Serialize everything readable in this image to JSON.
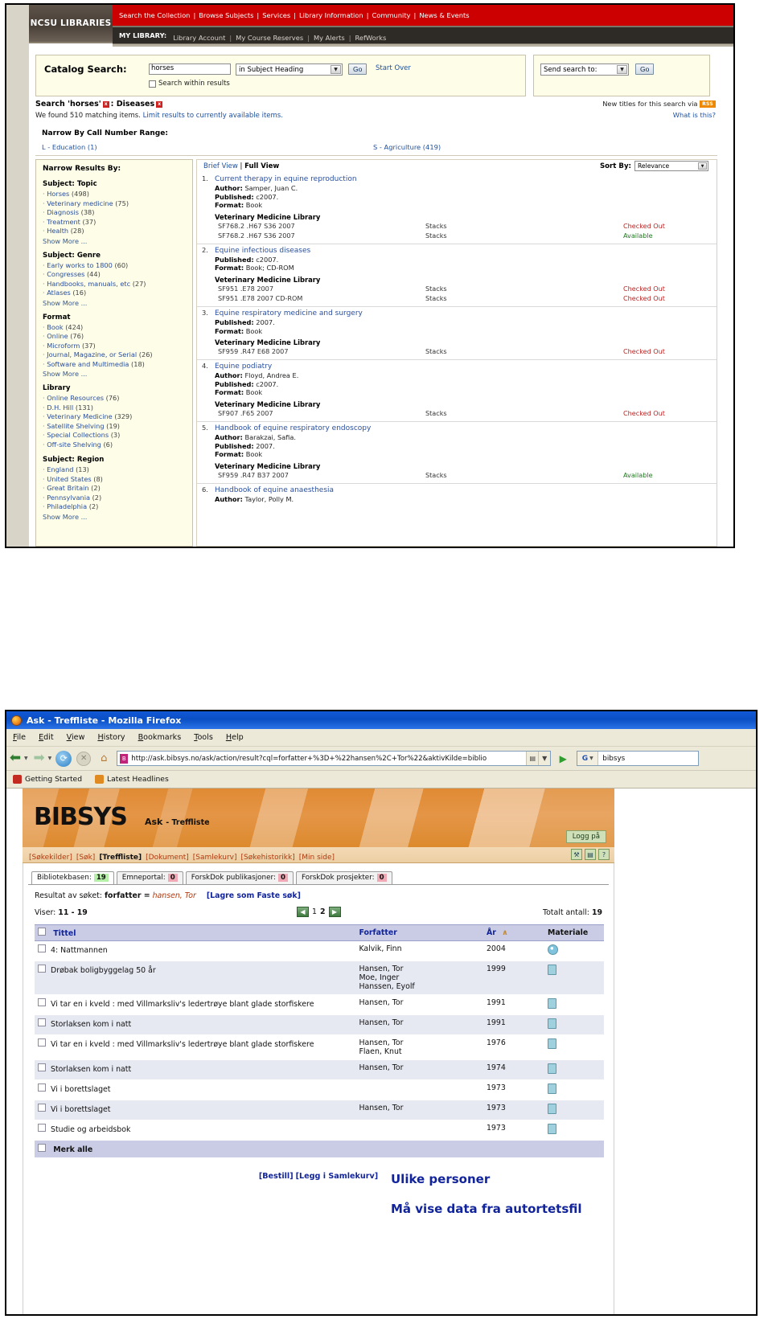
{
  "shot1": {
    "brand": "NCSU LIBRARIES",
    "topnav": [
      "Search the Collection",
      "Browse Subjects",
      "Services",
      "Library Information",
      "Community",
      "News & Events"
    ],
    "mylibrary_label": "MY LIBRARY:",
    "mylibrary_items": [
      "Library Account",
      "My Course Reserves",
      "My Alerts",
      "RefWorks"
    ],
    "search": {
      "label": "Catalog Search:",
      "value": "horses",
      "scope": "in Subject Heading",
      "go": "Go",
      "start_over": "Start Over",
      "within_results": "Search within results"
    },
    "send": {
      "select": "Send search to:",
      "go": "Go"
    },
    "search_line_prefix": "Search 'horses'",
    "search_line_facet": ": Diseases",
    "found_text": "We found 510 matching items. ",
    "found_link": "Limit results to currently available items.",
    "rss_text": "New titles for this search via ",
    "rss_badge": "RSS",
    "what_is_this": "What is this?",
    "callnum": {
      "heading": "Narrow By Call Number Range:",
      "left": "L - Education (1)",
      "right": "S - Agriculture (419)"
    },
    "facets": {
      "title": "Narrow Results By:",
      "show_more": "Show More ...",
      "groups": [
        {
          "head": "Subject: Topic",
          "items": [
            "Horses (498)",
            "Veterinary medicine (75)",
            "Diagnosis (38)",
            "Treatment (37)",
            "Health (28)"
          ],
          "more": true
        },
        {
          "head": "Subject: Genre",
          "items": [
            "Early works to 1800 (60)",
            "Congresses (44)",
            "Handbooks, manuals, etc (27)",
            "Atlases (16)"
          ],
          "more": true
        },
        {
          "head": "Format",
          "items": [
            "Book (424)",
            "Online (76)",
            "Microform (37)",
            "Journal, Magazine, or Serial (26)",
            "Software and Multimedia (18)"
          ],
          "more": true
        },
        {
          "head": "Library",
          "items": [
            "Online Resources (76)",
            "D.H. Hill (131)",
            "Veterinary Medicine (329)",
            "Satellite Shelving (19)",
            "Special Collections (3)",
            "Off-site Shelving (6)"
          ],
          "more": false
        },
        {
          "head": "Subject: Region",
          "items": [
            "England (13)",
            "United States (8)",
            "Great Britain (2)",
            "Pennsylvania (2)",
            "Philadelphia (2)"
          ],
          "more": true
        }
      ]
    },
    "results_header": {
      "brief_view": "Brief View",
      "separator": " | ",
      "full_view": "Full View",
      "sort_label": "Sort By:",
      "sort_value": "Relevance"
    },
    "results": [
      {
        "num": "1.",
        "title": "Current therapy in equine reproduction",
        "author": "Samper, Juan C.",
        "published": "c2007.",
        "format": "Book",
        "library": "Veterinary Medicine Library",
        "holdings": [
          {
            "call": "SF768.2 .H67 S36 2007",
            "loc": "Stacks",
            "status": "Checked Out",
            "ok": false
          },
          {
            "call": "SF768.2 .H67 S36 2007",
            "loc": "Stacks",
            "status": "Available",
            "ok": true
          }
        ]
      },
      {
        "num": "2.",
        "title": "Equine infectious diseases",
        "author": "",
        "published": "c2007.",
        "format": "Book; CD-ROM",
        "library": "Veterinary Medicine Library",
        "holdings": [
          {
            "call": "SF951 .E78 2007",
            "loc": "Stacks",
            "status": "Checked Out",
            "ok": false
          },
          {
            "call": "SF951 .E78 2007 CD-ROM",
            "loc": "Stacks",
            "status": "Checked Out",
            "ok": false
          }
        ]
      },
      {
        "num": "3.",
        "title": "Equine respiratory medicine and surgery",
        "author": "",
        "published": "2007.",
        "format": "Book",
        "library": "Veterinary Medicine Library",
        "holdings": [
          {
            "call": "SF959 .R47 E68 2007",
            "loc": "Stacks",
            "status": "Checked Out",
            "ok": false
          }
        ]
      },
      {
        "num": "4.",
        "title": "Equine podiatry",
        "author": "Floyd, Andrea E.",
        "published": "c2007.",
        "format": "Book",
        "library": "Veterinary Medicine Library",
        "holdings": [
          {
            "call": "SF907 .F65 2007",
            "loc": "Stacks",
            "status": "Checked Out",
            "ok": false
          }
        ]
      },
      {
        "num": "5.",
        "title": "Handbook of equine respiratory endoscopy",
        "author": "Barakzai, Safia.",
        "published": "2007.",
        "format": "Book",
        "library": "Veterinary Medicine Library",
        "holdings": [
          {
            "call": "SF959 .R47 B37 2007",
            "loc": "Stacks",
            "status": "Available",
            "ok": true
          }
        ]
      },
      {
        "num": "6.",
        "title": "Handbook of equine anaesthesia",
        "author": "Taylor, Polly M.",
        "published": "",
        "format": "",
        "library": "",
        "holdings": []
      }
    ],
    "labels": {
      "author": "Author:",
      "published": "Published:",
      "format": "Format:"
    }
  },
  "shot2": {
    "window_title": "Ask - Treffliste - Mozilla Firefox",
    "menu": [
      "File",
      "Edit",
      "View",
      "History",
      "Bookmarks",
      "Tools",
      "Help"
    ],
    "url": "http://ask.bibsys.no/ask/action/result?cql=forfatter+%3D+%22hansen%2C+Tor%22&aktivKilde=biblio",
    "search_engine": "G",
    "search_value": "bibsys",
    "bookmarks": [
      "Getting Started",
      "Latest Headlines"
    ],
    "logo": "BIBSYS",
    "app_title": "Ask",
    "app_subtitle": "- Treffliste",
    "login_button": "Logg på",
    "navstrip": [
      "[Søkekilder]",
      "[Søk]",
      "[Treffliste]",
      "[Dokument]",
      "[Samlekurv]",
      "[Søkehistorikk]",
      "[Min side]"
    ],
    "navstrip_active_index": 2,
    "nav_icons": [
      "tools-icon",
      "print-icon",
      "help-icon"
    ],
    "tabs": [
      {
        "label": "Bibliotekbasen:",
        "count": "19",
        "active": true
      },
      {
        "label": "Emneportal:",
        "count": "0",
        "active": false
      },
      {
        "label": "ForskDok publikasjoner:",
        "count": "0",
        "active": false
      },
      {
        "label": "ForskDok prosjekter:",
        "count": "0",
        "active": false
      }
    ],
    "result_prefix": "Resultat av søket:",
    "result_field": "forfatter =",
    "result_value": "hansen, Tor",
    "save_search_link": "[Lagre som Faste søk]",
    "viser_label": "Viser:",
    "viser_range": "11 - 19",
    "pager": {
      "prev": "◀",
      "next": "▶",
      "pages": [
        "1",
        "2"
      ],
      "current": "2"
    },
    "total_label": "Totalt antall:",
    "total_value": "19",
    "columns": [
      "Tittel",
      "Forfatter",
      "År",
      "Materiale"
    ],
    "sort_arrow": "∧",
    "rows": [
      {
        "title": "4: Nattmannen",
        "authors": [
          "Kalvik, Finn"
        ],
        "year": "2004",
        "media": "cd"
      },
      {
        "title": "Drøbak boligbyggelag 50 år",
        "authors": [
          "Hansen, Tor",
          "Moe, Inger",
          "Hanssen, Eyolf"
        ],
        "year": "1999",
        "media": "book"
      },
      {
        "title": "Vi tar en i kveld : med Villmarksliv's ledertrøye blant glade storfiskere",
        "authors": [
          "Hansen, Tor"
        ],
        "year": "1991",
        "media": "book"
      },
      {
        "title": "Storlaksen kom i natt",
        "authors": [
          "Hansen, Tor"
        ],
        "year": "1991",
        "media": "book"
      },
      {
        "title": "Vi tar en i kveld : med Villmarksliv's ledertrøye blant glade storfiskere",
        "authors": [
          "Hansen, Tor",
          "Flaen, Knut"
        ],
        "year": "1976",
        "media": "book"
      },
      {
        "title": "Storlaksen kom i natt",
        "authors": [
          "Hansen, Tor"
        ],
        "year": "1974",
        "media": "book"
      },
      {
        "title": "Vi i borettslaget",
        "authors": [],
        "year": "1973",
        "media": "book"
      },
      {
        "title": "Vi i borettslaget",
        "authors": [
          "Hansen, Tor"
        ],
        "year": "1973",
        "media": "book"
      },
      {
        "title": "Studie og arbeidsbok",
        "authors": [],
        "year": "1973",
        "media": "book"
      }
    ],
    "merk_alle": "Merk alle",
    "bottom_links": [
      "[Bestill]",
      "[Legg i Samlekurv]"
    ]
  },
  "annotations": {
    "line1": "Ulike personer",
    "line2": "Må vise data fra autortetsfil"
  }
}
